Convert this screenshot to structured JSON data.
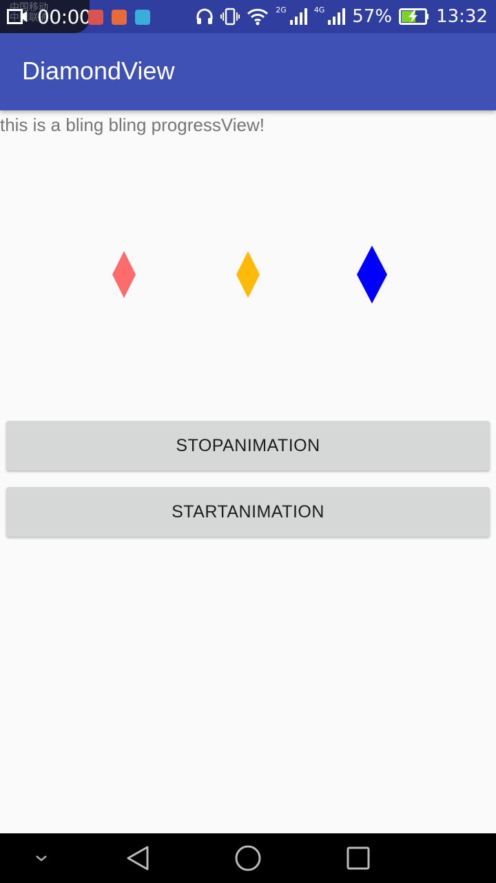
{
  "status_bar": {
    "recording_time": "00:00",
    "carrier_line1": "中国移动",
    "carrier_line2": "中国联通",
    "network_2g": "2G",
    "network_4g": "4G",
    "battery": "57%",
    "time": "13:32"
  },
  "app_bar": {
    "title": "DiamondView"
  },
  "main": {
    "description": "this is a bling bling progressView!",
    "diamonds": [
      {
        "color": "#fe6b6b"
      },
      {
        "color": "#ffba08"
      },
      {
        "color": "#0000ff"
      }
    ],
    "stop_button_label": "STOPANIMATION",
    "start_button_label": "STARTANIMATION"
  },
  "nav_bar": {
    "icons": [
      "chevron-down-icon",
      "back-icon",
      "home-icon",
      "recents-icon"
    ]
  }
}
